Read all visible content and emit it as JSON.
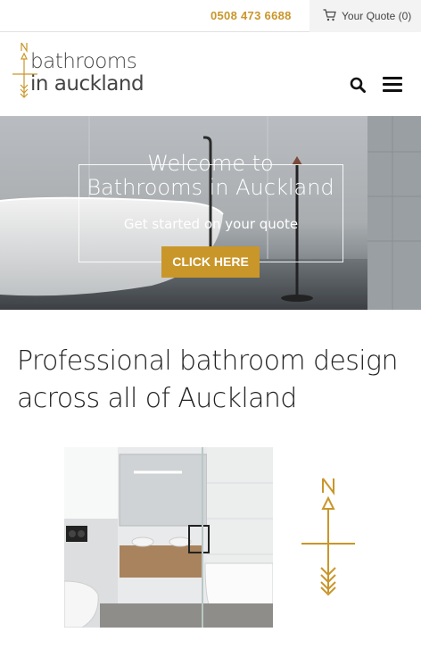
{
  "topbar": {
    "phone": "0508 473 6688",
    "quote_label": "Your Quote (0)",
    "quote_icon": "cart-icon"
  },
  "header": {
    "logo_line1": "bathrooms",
    "logo_line2": "in auckland",
    "search_icon": "search-icon",
    "menu_icon": "hamburger-menu-icon"
  },
  "hero": {
    "title_line1": "Welcome to",
    "title_line2": "Bathrooms in Auckland",
    "subtitle": "Get started on your quote",
    "button_label": "CLICK HERE"
  },
  "main": {
    "heading_line1": "Professional bathroom design",
    "heading_line2": "across all of Auckland"
  },
  "colors": {
    "accent": "#c9962a",
    "text": "#222222",
    "topbar_quote_bg": "#f3f3f3"
  }
}
